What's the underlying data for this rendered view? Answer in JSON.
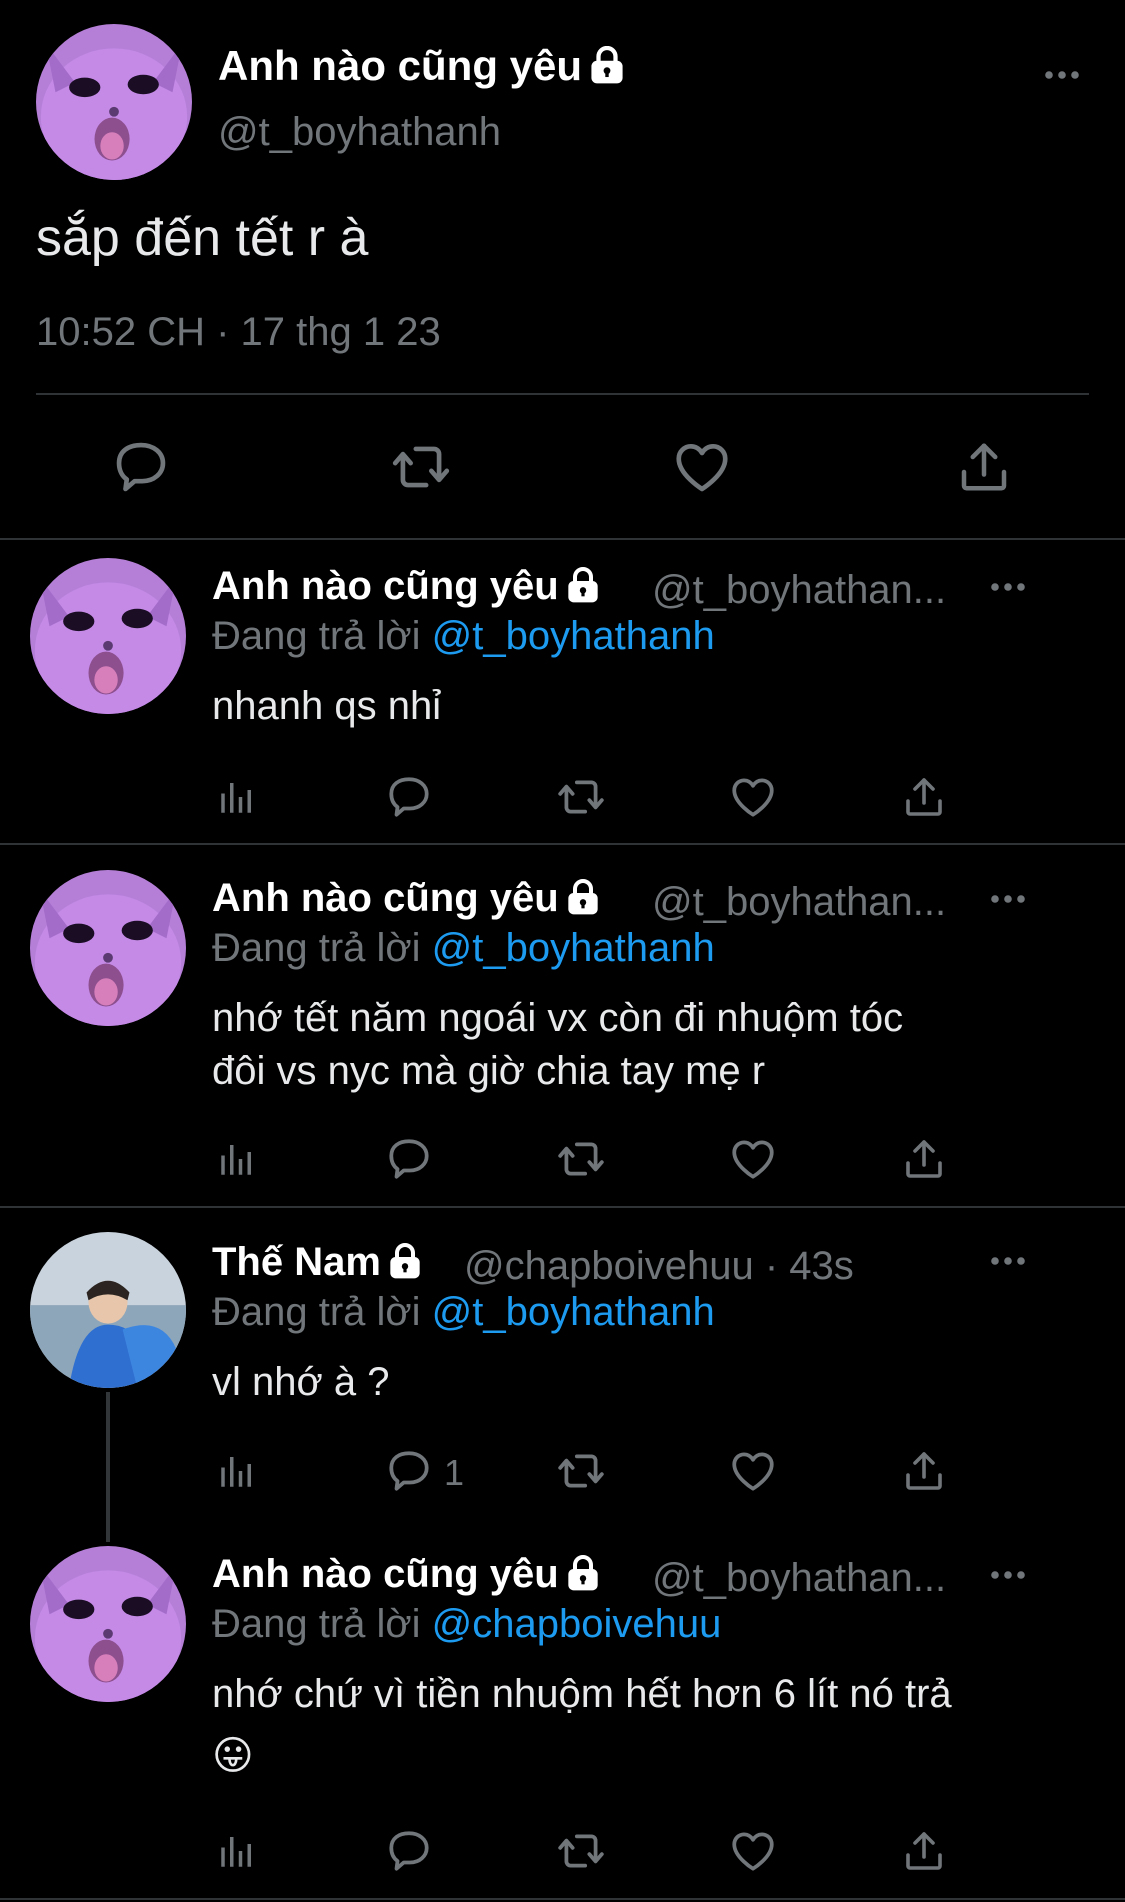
{
  "main_tweet": {
    "display_name": "Anh nào cũng yêu",
    "handle": "@t_boyhathanh",
    "text": "sắp đến tết r à",
    "timestamp": "10:52 CH · 17 thg 1 23",
    "avatar": "purple-cat-avatar"
  },
  "replying_to_label": "Đang trả lời",
  "replies": [
    {
      "display_name": "Anh nào cũng yêu",
      "handle": "@t_boyhathan...",
      "reply_to": "@t_boyhathanh",
      "text": "nhanh qs nhỉ",
      "avatar": "purple-cat-avatar"
    },
    {
      "display_name": "Anh nào cũng yêu",
      "handle": "@t_boyhathan...",
      "reply_to": "@t_boyhathanh",
      "text_line1": "nhớ tết năm ngoái vx còn đi nhuộm tóc",
      "text_line2": "đôi vs nyc mà giờ chia tay mẹ r",
      "avatar": "purple-cat-avatar"
    },
    {
      "display_name": "Thế Nam",
      "handle": "@chapboivehuu",
      "time": "· 43s",
      "reply_to": "@t_boyhathanh",
      "text": "vl nhớ à ?",
      "reply_count": "1",
      "avatar": "sea-photo-avatar"
    },
    {
      "display_name": "Anh nào cũng yêu",
      "handle": "@t_boyhathan...",
      "reply_to": "@chapboivehuu",
      "text_line1": "nhớ chứ vì tiền nhuộm hết hơn 6 lít nó trả",
      "emoji": "😛",
      "avatar": "purple-cat-avatar"
    }
  ],
  "icons": {
    "reply": "reply-icon",
    "retweet": "retweet-icon",
    "like": "like-icon",
    "share": "share-icon",
    "views": "views-icon",
    "more": "more-icon",
    "lock": "lock-icon"
  },
  "colors": {
    "background": "#000000",
    "text": "#e7e9ea",
    "muted": "#71767b",
    "link": "#1d9bf0",
    "divider": "#2f3336"
  }
}
